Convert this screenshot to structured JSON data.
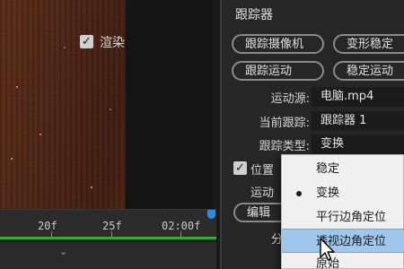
{
  "timeline": {
    "ticks": [
      "20f",
      "25f",
      "02:00f"
    ],
    "render_label": "渲染",
    "render_checked": true
  },
  "panel": {
    "title": "跟踪器",
    "buttons": {
      "track_camera": "跟踪摄像机",
      "warp_stabilize": "变形稳定",
      "track_motion": "跟踪运动",
      "stabilize_motion": "稳定运动"
    },
    "fields": {
      "motion_source_label": "运动源:",
      "motion_source_value": "电脑.mp4",
      "current_track_label": "当前跟踪:",
      "current_track_value": "跟踪器 1",
      "track_type_label": "跟踪类型:",
      "track_type_value": "变换",
      "position_label": "位置",
      "motion_label_partial": "运动",
      "edit_label_partial": "编辑",
      "analyze_label_partial": "分"
    }
  },
  "track_type_menu": {
    "items": [
      "稳定",
      "变换",
      "平行边角定位",
      "透视边角定位",
      "原始"
    ],
    "selected_index": 1,
    "highlighted_index": 3
  },
  "colors": {
    "panel_bg": "#262626",
    "menu_bg": "#f0f0f0",
    "menu_highlight": "#9fc7ec",
    "timeline_green": "#3da83d",
    "playhead_blue": "#2d8ceb"
  }
}
